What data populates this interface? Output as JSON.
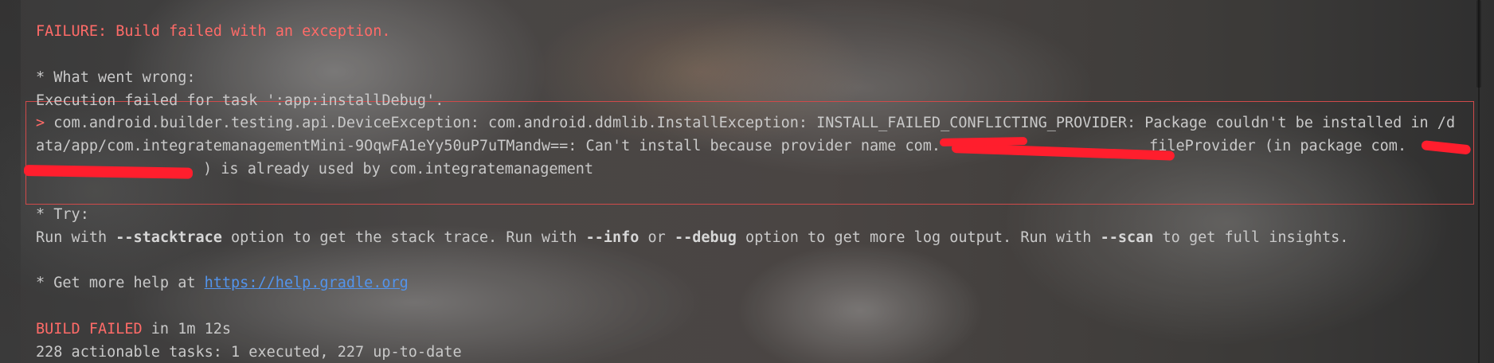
{
  "console": {
    "failure_header": "FAILURE: Build failed with an exception.",
    "what_went_wrong_heading": "* What went wrong:",
    "execution_failed": "Execution failed for task ':app:installDebug'.",
    "exception_prompt": ">",
    "exception_line1": "com.android.builder.testing.api.DeviceException: com.android.ddmlib.InstallException: INSTALL_FAILED_CONFLICTING_PROVIDER: Package couldn't be installed in /d",
    "exception_line2a": "ata/app/com.integratemanagementMini-9OqwFA1eYy50uP7uTMandw==: Can't install because provider name com.",
    "exception_line2b": "fileProvider (in package com.",
    "exception_line3": ") is already used by com.integratemanagement",
    "try_heading": "* Try:",
    "try_text": {
      "part1": "Run with ",
      "stacktrace": "--stacktrace",
      "part2": " option to get the stack trace. Run with ",
      "info": "--info",
      "part3": " or ",
      "debug": "--debug",
      "part4": " option to get more log output. Run with ",
      "scan": "--scan",
      "part5": " to get full insights."
    },
    "help_prefix": "* Get more help at ",
    "help_link": "https://help.gradle.org",
    "build_failed": "BUILD FAILED",
    "build_time": " in 1m 12s",
    "tasks_summary": "228 actionable tasks: 1 executed, 227 up-to-date"
  },
  "colors": {
    "error": "#ff6b68",
    "text": "#c9c9c9",
    "link": "#5394ec",
    "redaction": "#ff1e2d",
    "highlight_border": "#d04a4a"
  }
}
